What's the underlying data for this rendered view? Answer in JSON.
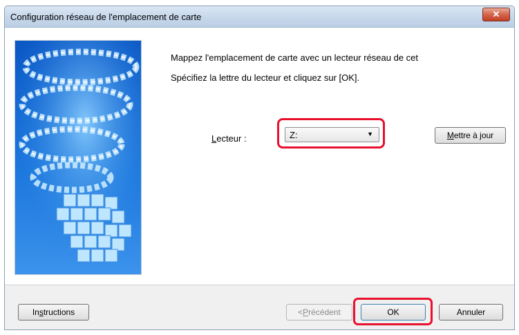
{
  "window": {
    "title": "Configuration réseau de l'emplacement de carte",
    "close_glyph": "✕"
  },
  "main": {
    "instruction_line1": "Mappez l'emplacement de carte avec un lecteur réseau de cet",
    "instruction_line2": "Spécifiez la lettre du lecteur et cliquez sur [OK].",
    "drive_label_first": "L",
    "drive_label_rest": "ecteur :",
    "drive_value": "Z:",
    "dropdown_arrow": "▼",
    "update_button_first": "M",
    "update_button_rest": "ettre à jour"
  },
  "footer": {
    "help_pre": "In",
    "help_acc": "s",
    "help_post": "tructions",
    "back_pre": "<",
    "back_acc": "P",
    "back_post": "récédent",
    "ok_label": "OK",
    "cancel_label": "Annuler"
  },
  "colors": {
    "highlight": "#e8102c",
    "banner_blue": "#1f73d6"
  },
  "icons": {
    "banner": "blue-card-spiral-graphic",
    "close": "close-icon",
    "dropdown": "chevron-down-icon"
  }
}
